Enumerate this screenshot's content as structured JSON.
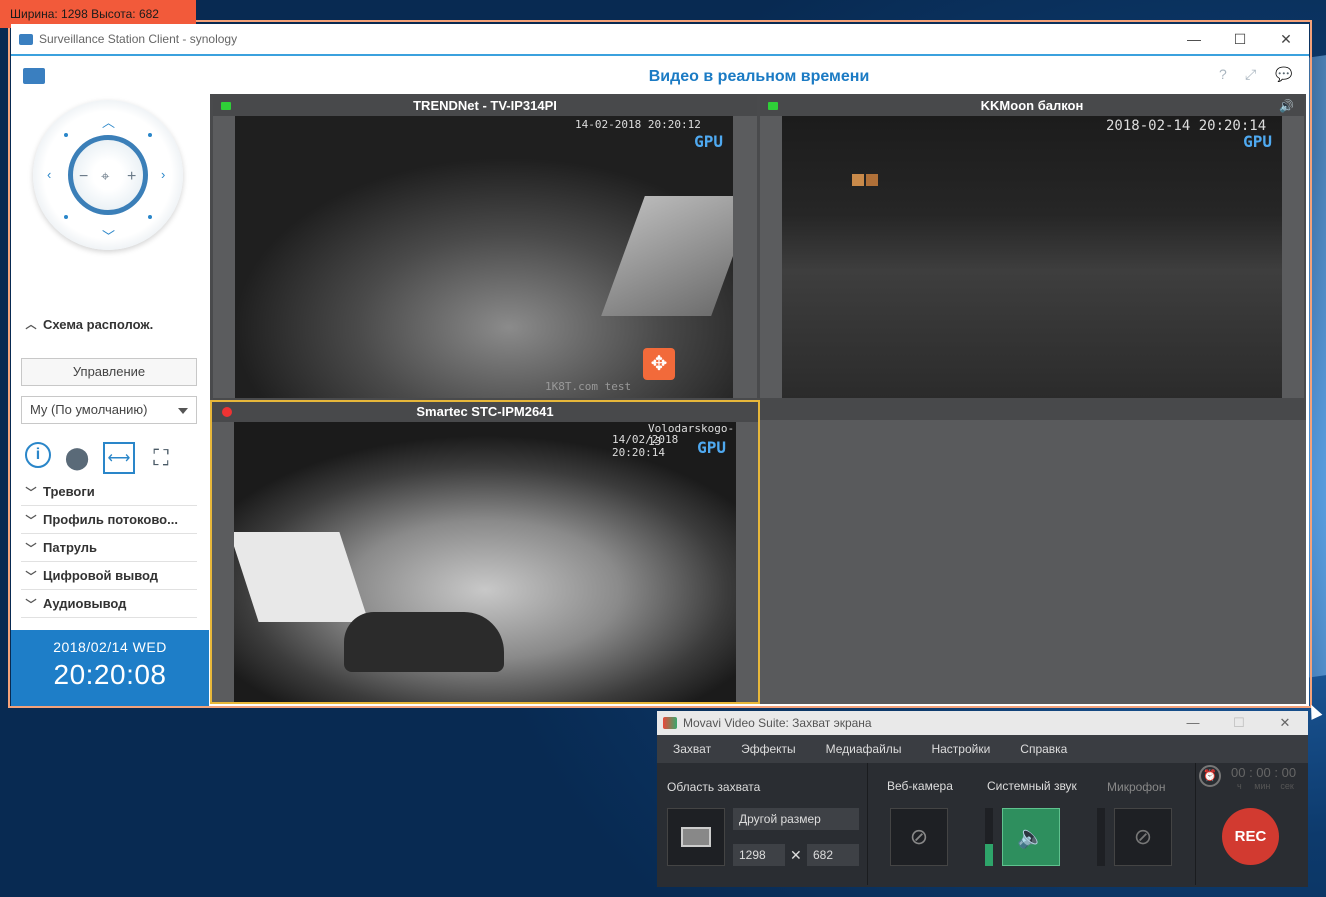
{
  "capture_badge": "Ширина: 1298  Высота: 682",
  "window": {
    "title": "Surveillance Station Client - synology",
    "controls": [
      "—",
      "☐",
      "✕"
    ]
  },
  "header": {
    "title": "Видео в реальном времени",
    "icons": [
      "help-icon",
      "fullscreen-icon",
      "chat-icon"
    ]
  },
  "sidebar": {
    "layout_section": "Схема располож.",
    "manage_button": "Управление",
    "layout_select": "My (По умолчанию)",
    "sections": [
      "Тревоги",
      "Профиль потоково...",
      "Патруль",
      "Цифровой вывод",
      "Аудиовывод"
    ]
  },
  "clock": {
    "date": "2018/02/14 WED",
    "time": "20:20:08"
  },
  "cameras": [
    {
      "name": "TRENDNet - TV-IP314PI",
      "timestamp": "14-02-2018 20:20:12",
      "gpu": "GPU",
      "watermark": "1K8T.com test"
    },
    {
      "name": "KKMoon балкон",
      "timestamp": "2018-02-14 20:20:14",
      "gpu": "GPU"
    },
    {
      "name": "Smartec STC-IPM2641",
      "timestamp": "Volodarskogo-13",
      "timestamp2": "14/02/2018  20:20:14",
      "gpu": "GPU"
    }
  ],
  "movavi": {
    "title": "Movavi Video Suite: Захват экрана",
    "controls": [
      "—",
      "☐",
      "✕"
    ],
    "menu": [
      "Захват",
      "Эффекты",
      "Медиафайлы",
      "Настройки",
      "Справка"
    ],
    "area_label": "Область захвата",
    "size_select": "Другой размер",
    "width": "1298",
    "height": "682",
    "times_sign": "✕",
    "webcam_label": "Веб-камера",
    "sysaudio_label": "Системный звук",
    "mic_label": "Микрофон",
    "timer": "00 : 00 : 00",
    "timer_units": "ч     мин    сек",
    "rec": "REC"
  }
}
